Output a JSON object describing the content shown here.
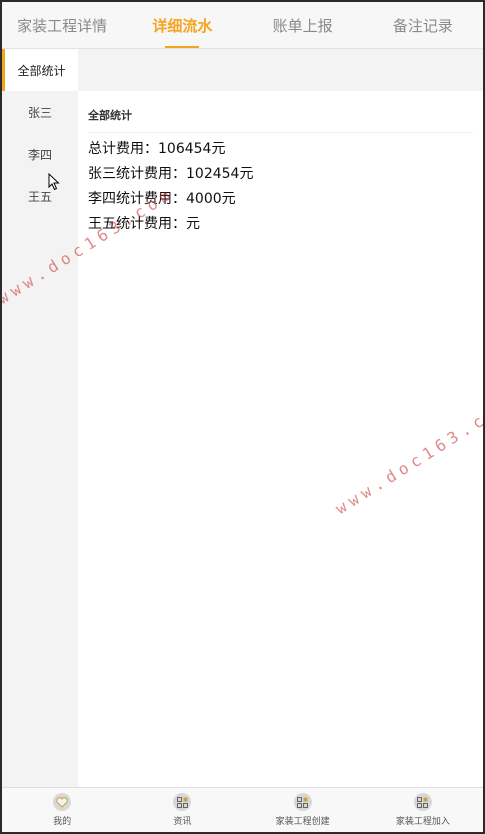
{
  "tabs": [
    {
      "label": "家装工程详情",
      "active": false
    },
    {
      "label": "详细流水",
      "active": true
    },
    {
      "label": "账单上报",
      "active": false
    },
    {
      "label": "备注记录",
      "active": false
    }
  ],
  "sidebar": {
    "items": [
      {
        "label": "全部统计",
        "active": true
      },
      {
        "label": "张三",
        "active": false
      },
      {
        "label": "李四",
        "active": false
      },
      {
        "label": "王五",
        "active": false
      }
    ]
  },
  "content": {
    "section_title": "全部统计",
    "stats": [
      "总计费用：106454元",
      "张三统计费用：102454元",
      "李四统计费用：4000元",
      "王五统计费用：元"
    ]
  },
  "bottom_nav": {
    "items": [
      {
        "label": "我的",
        "icon": "heart-icon"
      },
      {
        "label": "资讯",
        "icon": "grid-icon"
      },
      {
        "label": "家装工程创建",
        "icon": "grid-icon"
      },
      {
        "label": "家装工程加入",
        "icon": "grid-icon"
      }
    ]
  },
  "watermark": {
    "text1": "www.doc163.com",
    "text2": "www.doc163.com"
  },
  "colors": {
    "accent": "#f4a41f",
    "sidebar_bg": "#f3f3f3",
    "watermark": "#c82828"
  }
}
